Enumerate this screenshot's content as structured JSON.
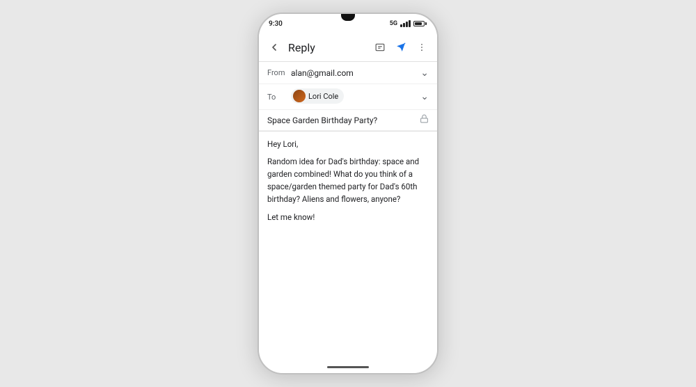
{
  "phone": {
    "status_bar": {
      "time": "9:30",
      "network": "5G",
      "signal_label": "signal"
    }
  },
  "app": {
    "title": "Reply",
    "back_label": "back",
    "toolbar": {
      "link_icon": "link",
      "send_icon": "send",
      "more_icon": "more-vertical"
    },
    "from_field": {
      "label": "From",
      "value": "alan@gmail.com"
    },
    "to_field": {
      "label": "To",
      "recipient": "Lori Cole"
    },
    "subject_field": {
      "value": "Space Garden Birthday Party?"
    },
    "body": {
      "greeting": "Hey Lori,",
      "paragraph1": "Random idea for Dad's birthday: space and garden combined! What do you think of a space/garden themed party for Dad's 60th birthday? Aliens and flowers, anyone?",
      "paragraph2": "Let me know!"
    }
  }
}
